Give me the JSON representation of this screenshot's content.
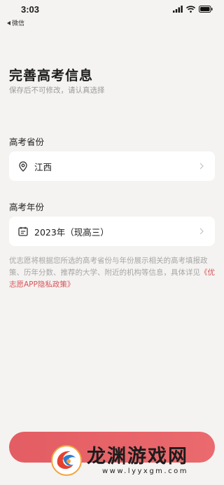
{
  "status_bar": {
    "time": "3:03",
    "back_label": "微信"
  },
  "header": {
    "title": "完善高考信息",
    "subtitle": "保存后不可修改，请认真选择"
  },
  "province": {
    "label": "高考省份",
    "value": "江西"
  },
  "year": {
    "label": "高考年份",
    "value": "2023年（现高三）"
  },
  "notice": {
    "text": "优志愿将根据您所选的高考省份与年份展示相关的高考填报政策、历年分数、推荐的大学、附近的机构等信息，具体详见",
    "policy_link": "《优志愿APP隐私政策》"
  },
  "watermark": {
    "brand": "龙渊游戏网",
    "url": "www.lyyxgm.com"
  },
  "colors": {
    "background": "#f4f3f1",
    "accent": "#e35d63",
    "card": "#ffffff"
  }
}
